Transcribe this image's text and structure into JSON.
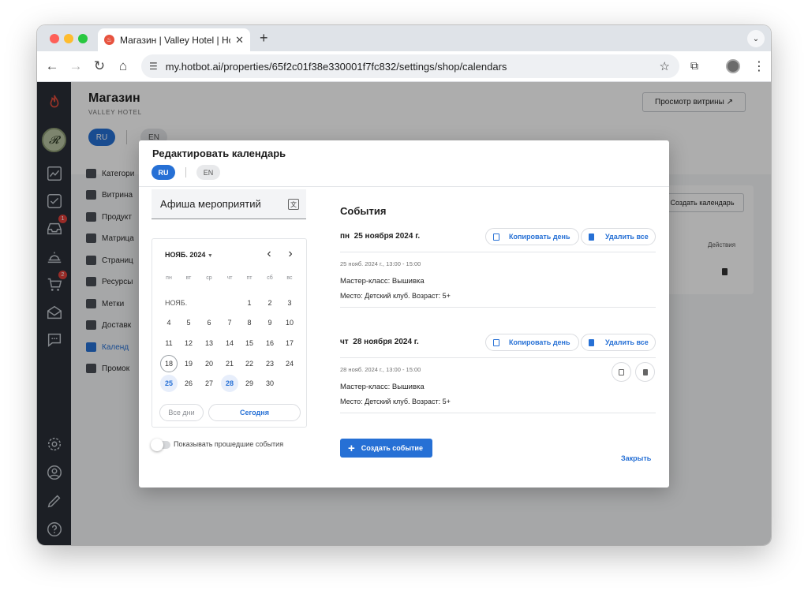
{
  "browser": {
    "tab_title": "Магазин | Valley Hotel | Hotbot",
    "url": "my.hotbot.ai/properties/65f2c01f38e330001f7fc832/settings/shop/calendars"
  },
  "page": {
    "title": "Магазин",
    "subtitle": "VALLEY HOTEL",
    "storefront_button": "Просмотр витрины ↗",
    "lang_ru": "RU",
    "lang_en": "EN",
    "create_calendar_button": "Создать календарь",
    "actions_header": "Действия"
  },
  "sidebar": {
    "badges": [
      "1",
      "2"
    ],
    "items": [
      {
        "label": "Категори"
      },
      {
        "label": "Витрина"
      },
      {
        "label": "Продукт"
      },
      {
        "label": "Матрица"
      },
      {
        "label": "Страниц"
      },
      {
        "label": "Ресурсы"
      },
      {
        "label": "Метки"
      },
      {
        "label": "Доставк"
      },
      {
        "label": "Календ",
        "active": true
      },
      {
        "label": "Промок"
      }
    ]
  },
  "modal": {
    "title": "Редактировать календарь",
    "lang_ru": "RU",
    "lang_en": "EN",
    "calendar_name": "Афиша мероприятий",
    "translate_icon": "translate-icon",
    "calendar": {
      "month_label": "НОЯБ. 2024",
      "month_short": "НОЯБ.",
      "weekdays": [
        "пн",
        "вт",
        "ср",
        "чт",
        "пт",
        "сб",
        "вс"
      ],
      "days": [
        "1",
        "2",
        "3",
        "4",
        "5",
        "6",
        "7",
        "8",
        "9",
        "10",
        "11",
        "12",
        "13",
        "14",
        "15",
        "16",
        "17",
        "18",
        "19",
        "20",
        "21",
        "22",
        "23",
        "24",
        "25",
        "26",
        "27",
        "28",
        "29",
        "30"
      ],
      "today": 18,
      "event_days": [
        25,
        28
      ],
      "btn_all": "Все дни",
      "btn_today": "Сегодня"
    },
    "toggle_label": "Показывать прошедшие события",
    "events_title": "События",
    "copy_day": "Копировать день",
    "delete_all": "Удалить все",
    "days": [
      {
        "weekday": "пн",
        "date": "25 ноября 2024 г.",
        "events": [
          {
            "time": "25 нояб. 2024 г., 13:00 - 15:00",
            "name": "Мастер-класс: Вышивка",
            "place": "Место: Детский клуб. Возраст: 5+"
          }
        ]
      },
      {
        "weekday": "чт",
        "date": "28 ноября 2024 г.",
        "events": [
          {
            "time": "28 нояб. 2024 г., 13:00 - 15:00",
            "name": "Мастер-класс: Вышивка",
            "place": "Место: Детский клуб. Возраст: 5+"
          }
        ]
      }
    ],
    "create_event": "Создать событие",
    "close": "Закрыть"
  }
}
